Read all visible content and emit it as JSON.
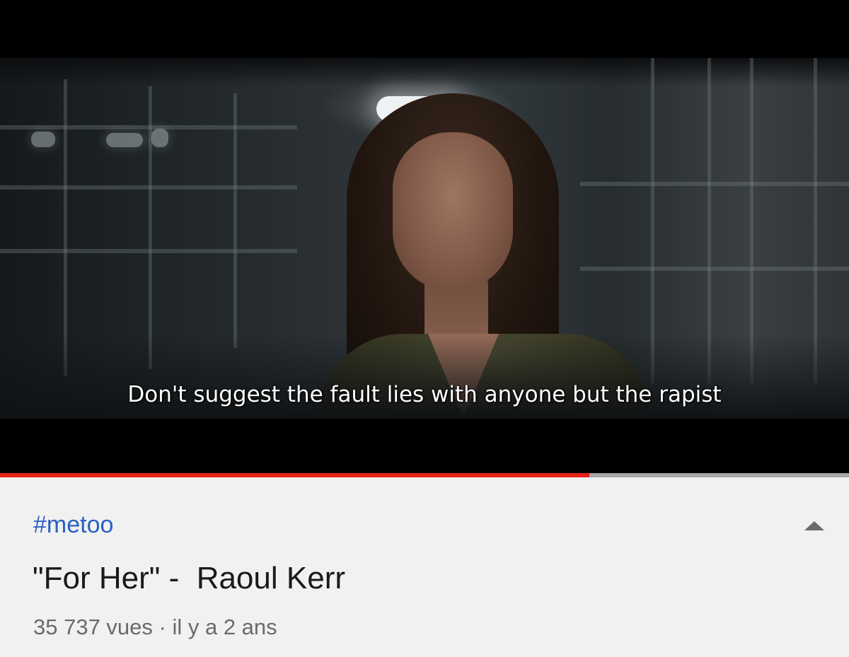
{
  "player": {
    "subtitle": "Don't suggest the fault lies with anyone but the rapist",
    "progress_fraction": 0.694
  },
  "video_info": {
    "hashtag": "#metoo",
    "title": "\"For Her\" -  Raoul Kerr",
    "meta": "35 737 vues · il y a 2 ans",
    "collapse_icon": "chevron-up-icon"
  },
  "colors": {
    "progress_played": "#e62117",
    "progress_unplayed": "#a7a7a7",
    "hashtag": "#2a5fc4",
    "background": "#f1f1f1"
  }
}
